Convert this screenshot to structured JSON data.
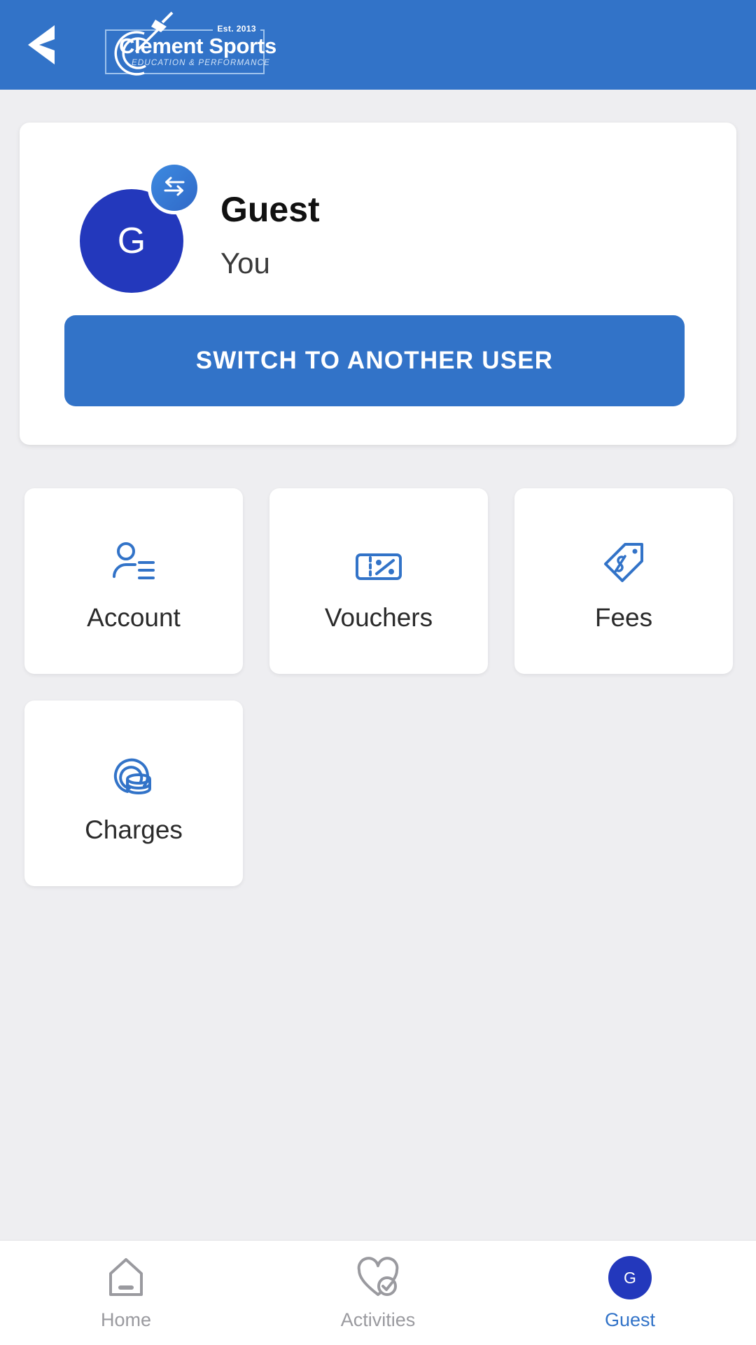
{
  "header": {
    "back_icon": "chevron-left-icon",
    "logo": {
      "name": "Clement Sports",
      "established": "Est.  2013",
      "tagline": "EDUCATION & PERFORMANCE",
      "mark_icon": "target-dart-icon"
    },
    "background_color": "#3273C8"
  },
  "profile": {
    "avatar_initial": "G",
    "avatar_color": "#2338BC",
    "swap_badge_icon": "swap-arrows-icon",
    "name": "Guest",
    "relation": "You",
    "switch_button_label": "SWITCH TO ANOTHER USER",
    "switch_button_color": "#3273C8"
  },
  "tiles": [
    {
      "label": "Account",
      "icon": "account-person-lines-icon"
    },
    {
      "label": "Vouchers",
      "icon": "voucher-ticket-percent-icon"
    },
    {
      "label": "Fees",
      "icon": "price-tag-dollar-icon"
    },
    {
      "label": "Charges",
      "icon": "coins-circle-icon"
    }
  ],
  "tile_icon_color": "#3273C8",
  "bottom_nav": {
    "items": [
      {
        "label": "Home",
        "icon": "home-icon",
        "active": false
      },
      {
        "label": "Activities",
        "icon": "heart-check-icon",
        "active": false
      },
      {
        "label": "Guest",
        "icon": "avatar-initial-icon",
        "initial": "G",
        "active": true
      }
    ],
    "active_color": "#3273C8",
    "inactive_color": "#9a9a9f"
  }
}
